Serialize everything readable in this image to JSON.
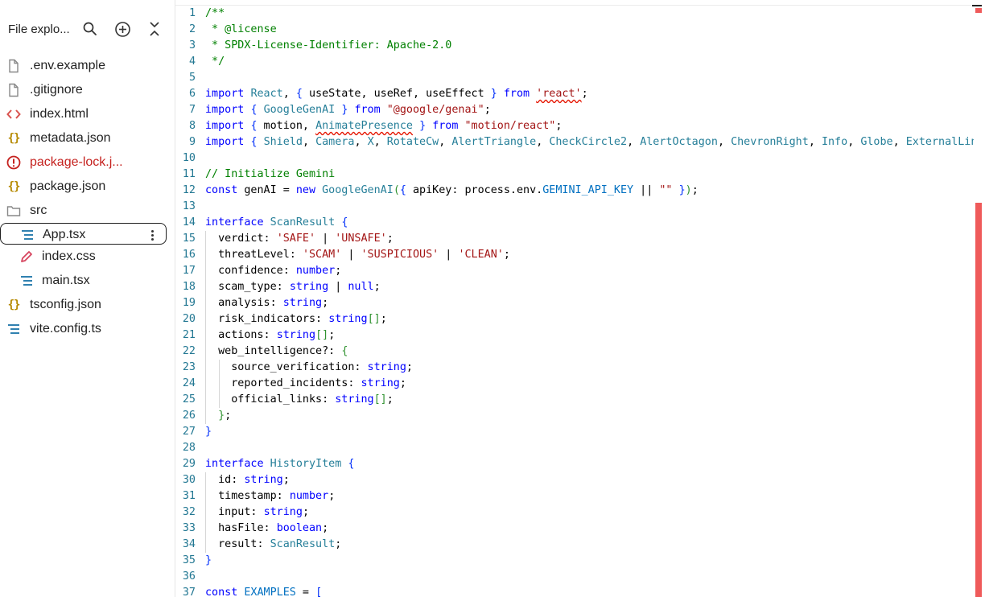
{
  "explorer": {
    "title": "File explo...",
    "items": [
      {
        "label": ".env.example",
        "icon": "file-icon",
        "color": "#222222",
        "indent": 0
      },
      {
        "label": ".gitignore",
        "icon": "file-icon",
        "color": "#222222",
        "indent": 0
      },
      {
        "label": "index.html",
        "icon": "html-icon",
        "color": "#222222",
        "indent": 0
      },
      {
        "label": "metadata.json",
        "icon": "json-icon",
        "color": "#222222",
        "indent": 0
      },
      {
        "label": "package-lock.j...",
        "icon": "error-icon",
        "color": "#c5221f",
        "indent": 0
      },
      {
        "label": "package.json",
        "icon": "json-icon",
        "color": "#222222",
        "indent": 0
      },
      {
        "label": "src",
        "icon": "folder-icon",
        "color": "#222222",
        "indent": 0
      },
      {
        "label": "App.tsx",
        "icon": "lines-icon",
        "color": "#222222",
        "indent": 1,
        "selected": true
      },
      {
        "label": "index.css",
        "icon": "pencil-icon",
        "color": "#222222",
        "indent": 1
      },
      {
        "label": "main.tsx",
        "icon": "lines-icon",
        "color": "#222222",
        "indent": 1
      },
      {
        "label": "tsconfig.json",
        "icon": "json-icon",
        "color": "#222222",
        "indent": 0
      },
      {
        "label": "vite.config.ts",
        "icon": "lines-icon",
        "color": "#222222",
        "indent": 0
      }
    ]
  },
  "colors": {
    "json_icon": "#b58900",
    "html_icon": "#d9534f",
    "error_icon": "#c5221f",
    "lines_icon": "#1a73a8",
    "pencil_icon": "#d6455f",
    "scrollbar": "#ef5a5a"
  },
  "code_lines": [
    [
      [
        "/**",
        "c"
      ]
    ],
    [
      [
        " * @license",
        "c"
      ]
    ],
    [
      [
        " * SPDX-License-Identifier: Apache-2.0",
        "c"
      ]
    ],
    [
      [
        " */",
        "c"
      ]
    ],
    [],
    [
      [
        "import",
        "k"
      ],
      [
        " ",
        ""
      ],
      [
        "React",
        "t"
      ],
      [
        ", ",
        ""
      ],
      [
        "{",
        "p"
      ],
      [
        " useState, useRef, useEffect ",
        ""
      ],
      [
        "}",
        "p"
      ],
      [
        " ",
        ""
      ],
      [
        "from",
        "k"
      ],
      [
        " ",
        ""
      ],
      [
        "'react'",
        "s sq"
      ],
      [
        ";",
        ""
      ]
    ],
    [
      [
        "import",
        "k"
      ],
      [
        " ",
        ""
      ],
      [
        "{",
        "p"
      ],
      [
        " ",
        ""
      ],
      [
        "GoogleGenAI",
        "t"
      ],
      [
        " ",
        ""
      ],
      [
        "}",
        "p"
      ],
      [
        " ",
        ""
      ],
      [
        "from",
        "k"
      ],
      [
        " ",
        ""
      ],
      [
        "\"@google/genai\"",
        "s"
      ],
      [
        ";",
        ""
      ]
    ],
    [
      [
        "import",
        "k"
      ],
      [
        " ",
        ""
      ],
      [
        "{",
        "p"
      ],
      [
        " motion, ",
        ""
      ],
      [
        "AnimatePresence",
        "t sq"
      ],
      [
        " ",
        ""
      ],
      [
        "}",
        "p"
      ],
      [
        " ",
        ""
      ],
      [
        "from",
        "k"
      ],
      [
        " ",
        ""
      ],
      [
        "\"motion/react\"",
        "s"
      ],
      [
        ";",
        ""
      ]
    ],
    [
      [
        "import",
        "k"
      ],
      [
        " ",
        ""
      ],
      [
        "{",
        "p"
      ],
      [
        " ",
        ""
      ],
      [
        "Shield",
        "t"
      ],
      [
        ", ",
        ""
      ],
      [
        "Camera",
        "t"
      ],
      [
        ", ",
        ""
      ],
      [
        "X",
        "t"
      ],
      [
        ", ",
        ""
      ],
      [
        "RotateCw",
        "t"
      ],
      [
        ", ",
        ""
      ],
      [
        "AlertTriangle",
        "t"
      ],
      [
        ", ",
        ""
      ],
      [
        "CheckCircle2",
        "t"
      ],
      [
        ", ",
        ""
      ],
      [
        "AlertOctagon",
        "t"
      ],
      [
        ", ",
        ""
      ],
      [
        "ChevronRight",
        "t"
      ],
      [
        ", ",
        ""
      ],
      [
        "Info",
        "t"
      ],
      [
        ", ",
        ""
      ],
      [
        "Globe",
        "t"
      ],
      [
        ", ",
        ""
      ],
      [
        "ExternalLink",
        "t"
      ]
    ],
    [],
    [
      [
        "// Initialize Gemini",
        "c"
      ]
    ],
    [
      [
        "const",
        "k"
      ],
      [
        " genAI = ",
        ""
      ],
      [
        "new",
        "k"
      ],
      [
        " ",
        ""
      ],
      [
        "GoogleGenAI",
        "t"
      ],
      [
        "(",
        "g"
      ],
      [
        "{",
        "p"
      ],
      [
        " apiKey: process.env.",
        ""
      ],
      [
        "GEMINI_API_KEY",
        "cst"
      ],
      [
        " || ",
        ""
      ],
      [
        "\"\"",
        "s"
      ],
      [
        " ",
        ""
      ],
      [
        "}",
        "p"
      ],
      [
        ")",
        "g"
      ],
      [
        ";",
        ""
      ]
    ],
    [],
    [
      [
        "interface",
        "k"
      ],
      [
        " ",
        ""
      ],
      [
        "ScanResult",
        "t"
      ],
      [
        " ",
        ""
      ],
      [
        "{",
        "p"
      ]
    ],
    [
      [
        "  verdict: ",
        ""
      ],
      [
        "'SAFE'",
        "s"
      ],
      [
        " | ",
        ""
      ],
      [
        "'UNSAFE'",
        "s"
      ],
      [
        ";",
        ""
      ]
    ],
    [
      [
        "  threatLevel: ",
        ""
      ],
      [
        "'SCAM'",
        "s"
      ],
      [
        " | ",
        ""
      ],
      [
        "'SUSPICIOUS'",
        "s"
      ],
      [
        " | ",
        ""
      ],
      [
        "'CLEAN'",
        "s"
      ],
      [
        ";",
        ""
      ]
    ],
    [
      [
        "  confidence: ",
        ""
      ],
      [
        "number",
        "k"
      ],
      [
        ";",
        ""
      ]
    ],
    [
      [
        "  scam_type: ",
        ""
      ],
      [
        "string",
        "k"
      ],
      [
        " | ",
        ""
      ],
      [
        "null",
        "k"
      ],
      [
        ";",
        ""
      ]
    ],
    [
      [
        "  analysis: ",
        ""
      ],
      [
        "string",
        "k"
      ],
      [
        ";",
        ""
      ]
    ],
    [
      [
        "  risk_indicators: ",
        ""
      ],
      [
        "string",
        "k"
      ],
      [
        "[]",
        "g"
      ],
      [
        ";",
        ""
      ]
    ],
    [
      [
        "  actions: ",
        ""
      ],
      [
        "string",
        "k"
      ],
      [
        "[]",
        "g"
      ],
      [
        ";",
        ""
      ]
    ],
    [
      [
        "  web_intelligence?: ",
        ""
      ],
      [
        "{",
        "g"
      ]
    ],
    [
      [
        "    source_verification: ",
        ""
      ],
      [
        "string",
        "k"
      ],
      [
        ";",
        ""
      ]
    ],
    [
      [
        "    reported_incidents: ",
        ""
      ],
      [
        "string",
        "k"
      ],
      [
        ";",
        ""
      ]
    ],
    [
      [
        "    official_links: ",
        ""
      ],
      [
        "string",
        "k"
      ],
      [
        "[]",
        "g"
      ],
      [
        ";",
        ""
      ]
    ],
    [
      [
        "  ",
        ""
      ],
      [
        "}",
        "g"
      ],
      [
        ";",
        ""
      ]
    ],
    [
      [
        "}",
        "p"
      ]
    ],
    [],
    [
      [
        "interface",
        "k"
      ],
      [
        " ",
        ""
      ],
      [
        "HistoryItem",
        "t"
      ],
      [
        " ",
        ""
      ],
      [
        "{",
        "p"
      ]
    ],
    [
      [
        "  id: ",
        ""
      ],
      [
        "string",
        "k"
      ],
      [
        ";",
        ""
      ]
    ],
    [
      [
        "  timestamp: ",
        ""
      ],
      [
        "number",
        "k"
      ],
      [
        ";",
        ""
      ]
    ],
    [
      [
        "  input: ",
        ""
      ],
      [
        "string",
        "k"
      ],
      [
        ";",
        ""
      ]
    ],
    [
      [
        "  hasFile: ",
        ""
      ],
      [
        "boolean",
        "k"
      ],
      [
        ";",
        ""
      ]
    ],
    [
      [
        "  result: ",
        ""
      ],
      [
        "ScanResult",
        "t"
      ],
      [
        ";",
        ""
      ]
    ],
    [
      [
        "}",
        "p"
      ]
    ],
    [],
    [
      [
        "const",
        "k"
      ],
      [
        " ",
        ""
      ],
      [
        "EXAMPLES",
        "cst"
      ],
      [
        " = ",
        ""
      ],
      [
        "[",
        "p"
      ]
    ]
  ]
}
